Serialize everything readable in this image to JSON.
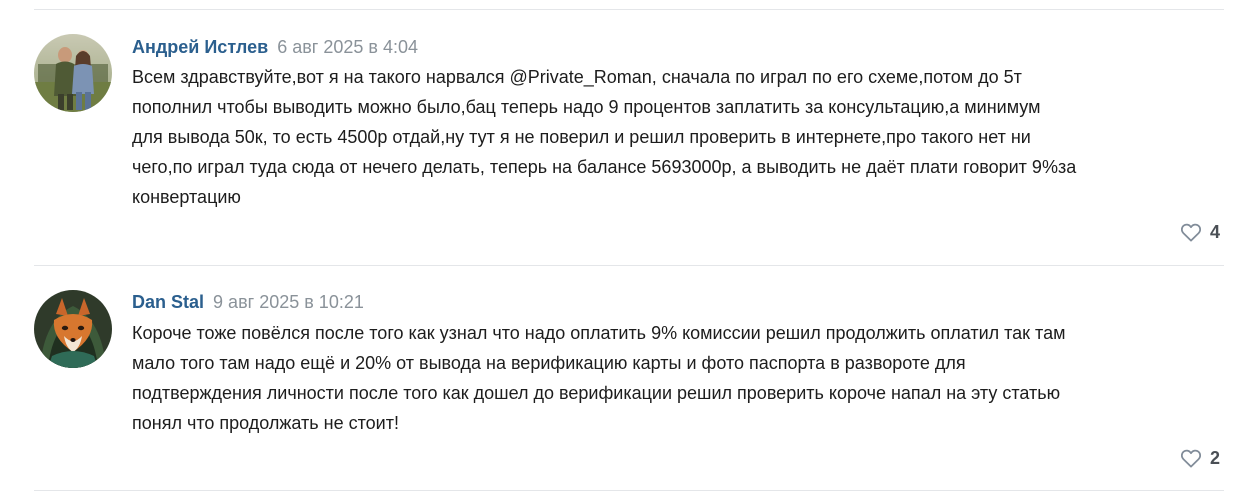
{
  "comments": [
    {
      "author": "Андрей Истлев",
      "date": "6 авг 2025 в 4:04",
      "avatar": "avatar-photo-two-people",
      "lines": [
        "Всем здравствуйте,вот я на такого нарвался @Private_Roman, сначала по играл по его схеме,потом до 5т",
        "пополнил чтобы выводить можно было,бац теперь надо 9 процентов заплатить за консультацию,а минимум",
        "для вывода 50к, то есть 4500р отдай,ну тут я не поверил и решил проверить в интернете,про такого нет ни",
        "чего,по играл туда сюда от нечего делать, теперь на балансе 5693000р, а выводить не даёт плати говорит 9%за",
        "конвертацию"
      ],
      "likes": "4",
      "like_icon": "heart-icon"
    },
    {
      "author": "Dan Stal",
      "date": "9 авг 2025 в 10:21",
      "avatar": "avatar-fox-in-hood",
      "lines": [
        "Короче тоже повёлся после того как узнал что надо оплатить 9% комиссии решил продолжить оплатил так там",
        "мало того там надо ещё и 20% от вывода на верификацию карты и фото паспорта в развороте для",
        "подтверждения личности после того как дошел до верификации решил проверить короче напал на эту статью",
        "понял что продолжать не стоит!"
      ],
      "likes": "2",
      "like_icon": "heart-icon"
    }
  ],
  "colors": {
    "author": "#2b5f8e",
    "date": "#8a9299",
    "divider": "#e4e6e9",
    "heart_outline": "#818c99"
  }
}
